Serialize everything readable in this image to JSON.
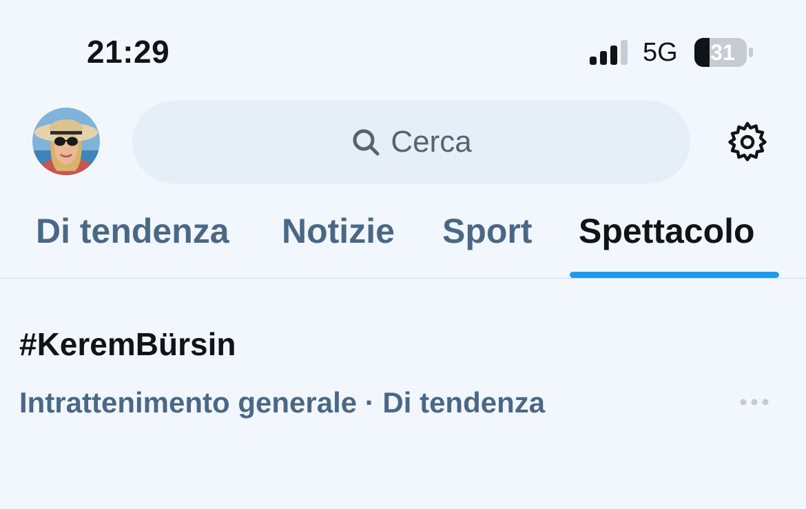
{
  "status_bar": {
    "time": "21:29",
    "network": "5G",
    "battery_level": "31",
    "icons": [
      "signal-icon",
      "battery-icon"
    ]
  },
  "header": {
    "avatar_icon": "profile-avatar",
    "search": {
      "placeholder": "Cerca",
      "icon": "search-icon"
    },
    "settings_icon": "gear-icon"
  },
  "tabs": [
    {
      "label": "Di tendenza",
      "active": false
    },
    {
      "label": "Notizie",
      "active": false
    },
    {
      "label": "Sport",
      "active": false
    },
    {
      "label": "Spettacolo",
      "active": true
    }
  ],
  "trend": {
    "title": "#KeremBürsin",
    "meta": "Intrattenimento generale · Di tendenza",
    "more_icon": "more-icon"
  },
  "colors": {
    "background": "#f2f7fd",
    "accent": "#1d9bf0",
    "text_primary": "#0f1419",
    "text_secondary": "#4a6886"
  }
}
